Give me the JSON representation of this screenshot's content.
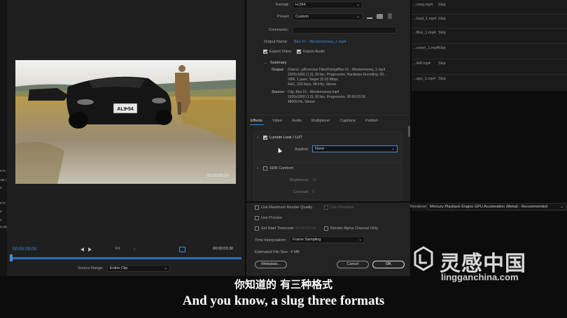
{
  "export_settings": {
    "format_label": "Format:",
    "format_value": "H.264",
    "preset_label": "Preset:",
    "preset_value": "Custom",
    "comments_label": "Comments:",
    "output_name_label": "Output Name:",
    "output_name_value": "Blur 01 - Westermoney_1.mp4",
    "export_video_label": "Export Video",
    "export_audio_label": "Export Audio",
    "summary_label": "Summary",
    "output_label": "Output:",
    "output_lines": [
      "/Users/...p/Exercise Files/Fixing/Blur 01 - Westermoney_1.mp4",
      "1920x1080 (1.0), 60 fps, Progressive, Hardware Encoding, 00...",
      "VBR, 1 pass, Target 10.00 Mbps",
      "AAC, 320 kbps, 48 kHz, Stereo"
    ],
    "source_label": "Source:",
    "source_lines": [
      "Clip, Blur 01 - Westermoney.mp4",
      "1920x1080 (1.0), 60 fps, Progressive, 00:00:03:30",
      "48000 Hz, Stereo"
    ]
  },
  "tabs": [
    "Effects",
    "Video",
    "Audio",
    "Multiplexer",
    "Captions",
    "Publish"
  ],
  "effects": {
    "lumetri_label": "Lumetri Look / LUT",
    "applied_label": "Applied:",
    "applied_value": "None",
    "sdr_label": "SDR Conform",
    "brightness_label": "Brightness:",
    "brightness_value": "10",
    "contrast_label": "Contrast:",
    "contrast_value": "0"
  },
  "bottom_options": {
    "max_render_quality": "Use Maximum Render Quality",
    "use_previews": "Use Previews",
    "use_proxies": "Use Proxies",
    "set_start_timecode": "Set Start Timecode",
    "start_timecode_value": "00:00:00:00",
    "render_alpha": "Render Alpha Channel Only",
    "time_interp_label": "Time Interpolation:",
    "time_interp_value": "Frame Sampling",
    "file_size_label": "Estimated File Size:",
    "file_size_value": "4 MB",
    "metadata_button": "Metadata...",
    "cancel_button": "Cancel",
    "ok_button": "OK"
  },
  "renderer": {
    "label": "Renderer:",
    "value": "Mercury Playback Engine GPU Acceleration (Metal) - Recommended"
  },
  "queue": {
    "items": [
      {
        "name": "...oney.mp4",
        "status": "Skip"
      },
      {
        "name": "...load_1.mp4",
        "status": "Skip"
      },
      {
        "name": "...Blur_1.mp4",
        "status": "Skip"
      },
      {
        "name": "...creen_1.mp4",
        "status": "Skip"
      },
      {
        "name": "...iHP.mp4",
        "status": "Skip"
      },
      {
        "name": "...ape_1.mp4",
        "status": "Skip"
      }
    ]
  },
  "preview": {
    "timecode_start": "00:00:00:00",
    "timecode_end": "00:00:03:30",
    "timecode_overlay": "00:00:00:00",
    "fit_label": "Fit",
    "source_range_label": "Source Range:",
    "source_range_value": "Entire Clip",
    "license_plate": "AL9•54"
  },
  "left_edge_labels": [
    "KTv",
    "Vat (",
    "4",
    "KTv",
    "4",
    "4",
    "Color"
  ],
  "watermark": {
    "brand_cn": "灵感中国",
    "domain": "lingganchina.com"
  },
  "subtitles": {
    "chinese": "你知道的 有三种格式",
    "english": "And you know, a slug three formats"
  },
  "colors": {
    "accent_blue": "#3d8fd8",
    "panel_bg": "#232323",
    "background": "#0c0c0c"
  }
}
